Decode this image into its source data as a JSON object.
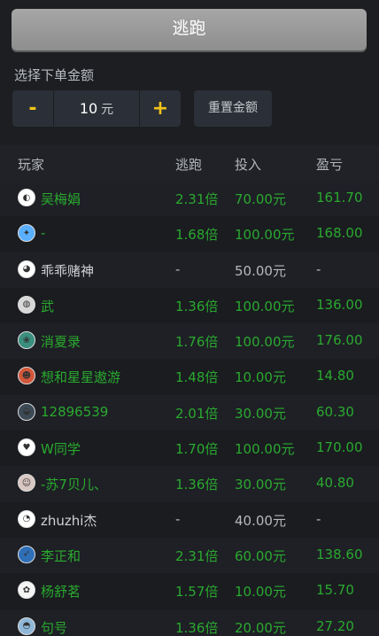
{
  "escape_button": {
    "label": "逃跑"
  },
  "amount": {
    "label": "选择下单金额",
    "minus": "-",
    "value": "10",
    "unit": "元",
    "plus": "+",
    "reset_label": "重置金额"
  },
  "table": {
    "headers": {
      "player": "玩家",
      "multiplier": "逃跑",
      "bet": "投入",
      "profit": "盈亏"
    },
    "rows": [
      {
        "name": "吴梅娟",
        "multiplier": "2.31倍",
        "bet": "70.00元",
        "profit": "161.70",
        "status": "win",
        "avatar_color": "#ffffff",
        "avatar_glyph": "◐"
      },
      {
        "name": "-",
        "multiplier": "1.68倍",
        "bet": "100.00元",
        "profit": "168.00",
        "status": "win",
        "avatar_color": "#5ab0ff",
        "avatar_glyph": "✦"
      },
      {
        "name": "乖乖赌神",
        "multiplier": "-",
        "bet": "50.00元",
        "profit": "-",
        "status": "neutral",
        "avatar_color": "#ffffff",
        "avatar_glyph": "◕"
      },
      {
        "name": "武",
        "multiplier": "1.36倍",
        "bet": "100.00元",
        "profit": "136.00",
        "status": "win",
        "avatar_color": "#d8d8d8",
        "avatar_glyph": "◍"
      },
      {
        "name": "消夏录",
        "multiplier": "1.76倍",
        "bet": "100.00元",
        "profit": "176.00",
        "status": "win",
        "avatar_color": "#3a8f7f",
        "avatar_glyph": "❀"
      },
      {
        "name": "想和星星遨游",
        "multiplier": "1.48倍",
        "bet": "10.00元",
        "profit": "14.80",
        "status": "win",
        "avatar_color": "#d2573a",
        "avatar_glyph": "☻"
      },
      {
        "name": "12896539",
        "multiplier": "2.01倍",
        "bet": "30.00元",
        "profit": "60.30",
        "status": "win",
        "avatar_color": "#3c4a56",
        "avatar_glyph": "◒"
      },
      {
        "name": "W同学",
        "multiplier": "1.70倍",
        "bet": "100.00元",
        "profit": "170.00",
        "status": "win",
        "avatar_color": "#ffffff",
        "avatar_glyph": "♥"
      },
      {
        "name": "-苏7贝儿、",
        "multiplier": "1.36倍",
        "bet": "30.00元",
        "profit": "40.80",
        "status": "win",
        "avatar_color": "#d9c7c2",
        "avatar_glyph": "☺"
      },
      {
        "name": "zhuzhi杰",
        "multiplier": "-",
        "bet": "40.00元",
        "profit": "-",
        "status": "neutral",
        "avatar_color": "#ffffff",
        "avatar_glyph": "◔"
      },
      {
        "name": "李正和",
        "multiplier": "2.31倍",
        "bet": "60.00元",
        "profit": "138.60",
        "status": "win",
        "avatar_color": "#2f6fb8",
        "avatar_glyph": "➶"
      },
      {
        "name": "杨舒茗",
        "multiplier": "1.57倍",
        "bet": "10.00元",
        "profit": "15.70",
        "status": "win",
        "avatar_color": "#f5f5f5",
        "avatar_glyph": "✿"
      },
      {
        "name": "句号",
        "multiplier": "1.36倍",
        "bet": "20.00元",
        "profit": "27.20",
        "status": "win",
        "avatar_color": "#8fb7d8",
        "avatar_glyph": "◓"
      }
    ]
  },
  "colors": {
    "win": "#2aa92f",
    "neutral": "#b6b8bb",
    "accent": "#f2c418",
    "background": "#1c1e21"
  }
}
